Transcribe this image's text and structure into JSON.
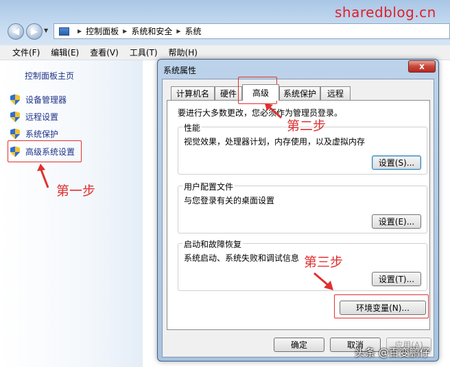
{
  "watermark_site": "sharedblog.cn",
  "watermark_bottom": "头条 @百变鹏仔",
  "address": {
    "crumbs": [
      "控制面板",
      "系统和安全",
      "系统"
    ]
  },
  "menu": [
    "文件(F)",
    "编辑(E)",
    "查看(V)",
    "工具(T)",
    "帮助(H)"
  ],
  "left_pane": {
    "home": "控制面板主页",
    "links": [
      "设备管理器",
      "远程设置",
      "系统保护",
      "高级系统设置"
    ]
  },
  "annotations": {
    "step1": "第一步",
    "step2": "第二步",
    "step3": "第三步"
  },
  "dialog": {
    "title": "系统属性",
    "close": "x",
    "tabs": [
      "计算机名",
      "硬件",
      "高级",
      "系统保护",
      "远程"
    ],
    "active_tab": "高级",
    "admin_note": "要进行大多数更改，您必须作为管理员登录。",
    "groups": [
      {
        "title": "性能",
        "desc": "视觉效果，处理器计划，内存使用，以及虚拟内存",
        "button": "设置(S)..."
      },
      {
        "title": "用户配置文件",
        "desc": "与您登录有关的桌面设置",
        "button": "设置(E)..."
      },
      {
        "title": "启动和故障恢复",
        "desc": "系统启动、系统失败和调试信息",
        "button": "设置(T)..."
      }
    ],
    "env_button": "环境变量(N)...",
    "ok": "确定",
    "cancel": "取消",
    "apply": "应用(A)"
  },
  "colors": {
    "annotation_red": "#e03030",
    "link_blue": "#1e3287"
  }
}
